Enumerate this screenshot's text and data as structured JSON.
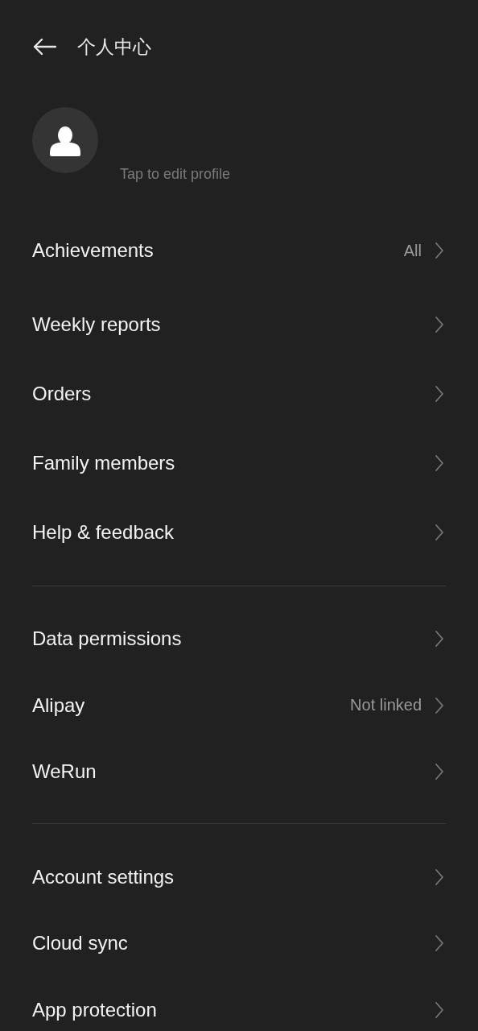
{
  "header": {
    "title": "个人中心"
  },
  "profile": {
    "hint": "Tap to edit profile"
  },
  "sections": [
    {
      "items": [
        {
          "label": "Achievements",
          "value": "All"
        }
      ]
    },
    {
      "items": [
        {
          "label": "Weekly reports"
        },
        {
          "label": "Orders"
        },
        {
          "label": "Family members"
        },
        {
          "label": "Help & feedback"
        }
      ]
    },
    {
      "items": [
        {
          "label": "Data permissions"
        },
        {
          "label": "Alipay",
          "value": "Not linked"
        },
        {
          "label": "WeRun"
        }
      ]
    },
    {
      "items": [
        {
          "label": "Account settings"
        },
        {
          "label": "Cloud sync"
        },
        {
          "label": "App protection"
        }
      ]
    }
  ]
}
